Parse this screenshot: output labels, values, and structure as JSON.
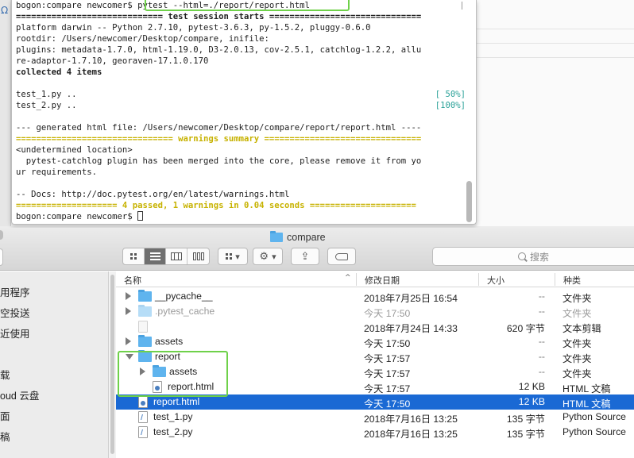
{
  "editor": {
    "left_glyph": "Ω"
  },
  "terminal": {
    "lines": [
      {
        "text": "bogon:compare newcomer$ pytest --html=./report/report.html"
      },
      {
        "text": "============================= test session starts =============================="
      },
      {
        "text": "platform darwin -- Python 2.7.10, pytest-3.6.3, py-1.5.2, pluggy-0.6.0"
      },
      {
        "text": "rootdir: /Users/newcomer/Desktop/compare, inifile:"
      },
      {
        "text": "plugins: metadata-1.7.0, html-1.19.0, D3-2.0.13, cov-2.5.1, catchlog-1.2.2, allu"
      },
      {
        "text": "re-adaptor-1.7.10, georaven-17.1.0.170"
      },
      {
        "text": "collected 4 items"
      },
      {
        "text": ""
      },
      {
        "text": "test_1.py ..",
        "progress": "[ 50%]"
      },
      {
        "text": "test_2.py ..",
        "progress": "[100%]"
      },
      {
        "text": ""
      },
      {
        "text": "--- generated html file: /Users/newcomer/Desktop/compare/report/report.html ----"
      },
      {
        "text": "=============================== warnings summary ==============================="
      },
      {
        "text": "<undetermined location>"
      },
      {
        "text": "  pytest-catchlog plugin has been merged into the core, please remove it from yo"
      },
      {
        "text": "ur requirements."
      },
      {
        "text": ""
      },
      {
        "text": "-- Docs: http://doc.pytest.org/en/latest/warnings.html"
      },
      {
        "text": "==================== 4 passed, 1 warnings in 0.04 seconds ====================="
      },
      {
        "text": "bogon:compare newcomer$ "
      }
    ]
  },
  "finder": {
    "title": "compare",
    "toolbar": {
      "view_icons": [
        "icon-view-icon",
        "list-view-icon",
        "column-view-icon",
        "cover-flow-icon"
      ],
      "group_icon": "▾",
      "action_icon": "⚙",
      "share_icon": "⇪",
      "tag_icon": "tag-icon"
    },
    "search_placeholder": "搜索",
    "sidebar_items": [
      "用程序",
      "空投送",
      "近使用",
      "载",
      "oud 云盘",
      "面",
      "稿"
    ],
    "columns": {
      "name": "名称",
      "date": "修改日期",
      "size": "大小",
      "kind": "种类"
    },
    "files": [
      {
        "name": "__pycache__",
        "date": "2018年7月25日 16:54",
        "size": "--",
        "kind": "文件夹",
        "type": "folder",
        "disclosure": "closed",
        "indent": 0
      },
      {
        "name": ".pytest_cache",
        "date": "今天 17:50",
        "size": "--",
        "kind": "文件夹",
        "type": "folder-faded",
        "disclosure": "closed",
        "indent": 0,
        "muted": true
      },
      {
        "name": "",
        "date": "2018年7月24日 14:33",
        "size": "620 字节",
        "kind": "文本剪辑",
        "type": "blank",
        "disclosure": "none",
        "indent": 0
      },
      {
        "name": "assets",
        "date": "今天 17:50",
        "size": "--",
        "kind": "文件夹",
        "type": "folder",
        "disclosure": "closed",
        "indent": 0
      },
      {
        "name": "report",
        "date": "今天 17:57",
        "size": "--",
        "kind": "文件夹",
        "type": "folder",
        "disclosure": "open",
        "indent": 0
      },
      {
        "name": "assets",
        "date": "今天 17:57",
        "size": "--",
        "kind": "文件夹",
        "type": "folder",
        "disclosure": "closed",
        "indent": 1
      },
      {
        "name": "report.html",
        "date": "今天 17:57",
        "size": "12 KB",
        "kind": "HTML 文稿",
        "type": "html",
        "disclosure": "none",
        "indent": 1
      },
      {
        "name": "report.html",
        "date": "今天 17:50",
        "size": "12 KB",
        "kind": "HTML 文稿",
        "type": "html",
        "disclosure": "none",
        "indent": 0,
        "selected": true
      },
      {
        "name": "test_1.py",
        "date": "2018年7月16日 13:25",
        "size": "135 字节",
        "kind": "Python Source",
        "type": "py",
        "disclosure": "none",
        "indent": 0
      },
      {
        "name": "test_2.py",
        "date": "2018年7月16日 13:25",
        "size": "135 字节",
        "kind": "Python Source",
        "type": "py",
        "disclosure": "none",
        "indent": 0
      }
    ]
  },
  "colors": {
    "selection": "#1a69d4",
    "highlight_box": "#6fd14a",
    "folder": "#5fb4ee",
    "terminal_yellow": "#c7b200",
    "terminal_cyan": "#2aa198"
  }
}
